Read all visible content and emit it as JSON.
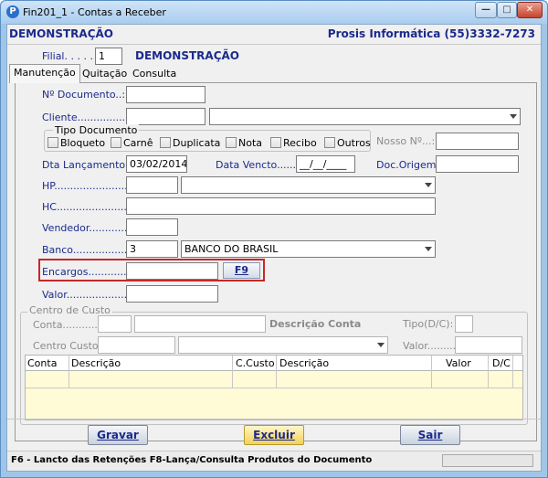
{
  "window": {
    "title": "Fin201_1 - Contas a Receber"
  },
  "header": {
    "title": "DEMONSTRAÇÃO",
    "company": "Prosis Informática (55)3332-7273"
  },
  "filial": {
    "label": "Filial. . . . . :",
    "value": "1",
    "name": "DEMONSTRAÇÃO"
  },
  "tabs": [
    "Manutenção",
    "Quitação",
    "Consulta"
  ],
  "form": {
    "documento_label": "Nº Documento..:",
    "cliente_label": "Cliente.................:",
    "tipo_documento": {
      "title": "Tipo Documento",
      "options": [
        "Bloqueto",
        "Carnê",
        "Duplicata",
        "Nota",
        "Recibo",
        "Outros"
      ]
    },
    "nosso_label": "Nosso Nº...:",
    "dta_lancamento_label": "Dta Lançamento:",
    "dta_lancamento_value": "03/02/2014",
    "data_vencto_label": "Data Vencto.......:",
    "data_vencto_value": "__/__/____",
    "doc_origem_label": "Doc.Origem:",
    "hp_label": "HP...........................:",
    "hc_label": "HC...........................:",
    "vendedor_label": "Vendedor.............:",
    "banco_label": "Banco...................:",
    "banco_code": "3",
    "banco_name": "BANCO DO BRASIL",
    "encargos_label": "Encargos...............:",
    "f9_label": "F9",
    "valor_label": "Valor.........................:"
  },
  "centro": {
    "title": "Centro de Custo",
    "conta_label": "Conta.............",
    "descricao_conta": "Descrição Conta",
    "tipo_label": "Tipo(D/C):",
    "centro_label": "Centro Custo:",
    "valor_label": "Valor.........:"
  },
  "grid": {
    "headers": [
      "Conta",
      "Descrição",
      "C.Custo",
      "Descrição",
      "Valor",
      "D/C"
    ]
  },
  "buttons": {
    "gravar": "Gravar",
    "excluir": "Excluir",
    "sair": "Sair"
  },
  "status": "F6 - Lancto das Retenções  F8-Lança/Consulta Produtos do Documento",
  "colors": {
    "label": "#1b2a8c",
    "highlight": "#c62828",
    "grid_bg": "#fffbd6"
  }
}
